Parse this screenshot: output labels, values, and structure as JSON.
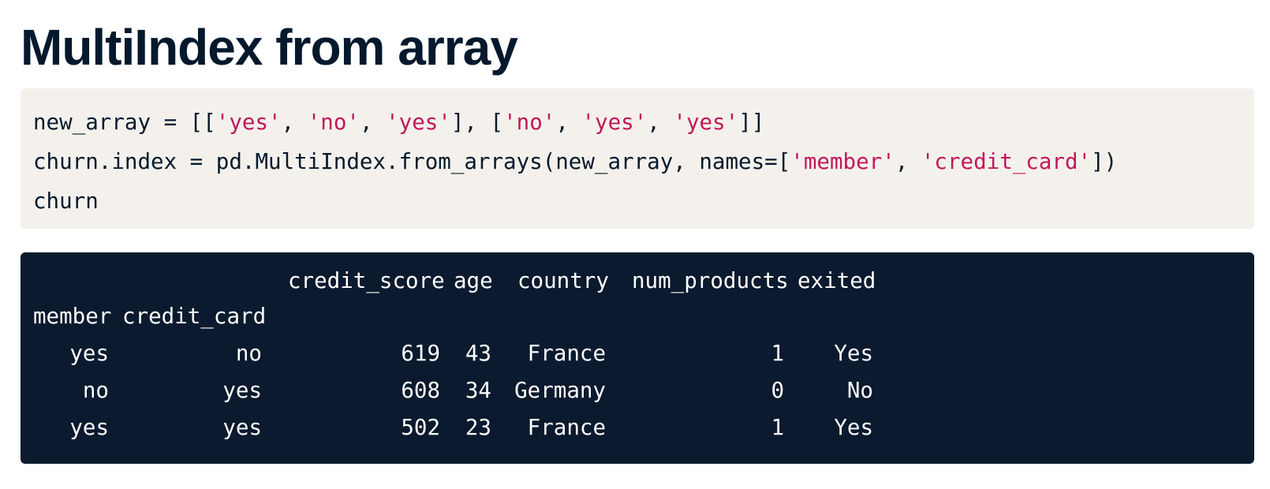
{
  "page": {
    "title": "MultiIndex from array"
  },
  "code_input": {
    "line1": [
      {
        "t": "new_array = [[",
        "s": false
      },
      {
        "t": "'yes'",
        "s": true
      },
      {
        "t": ", ",
        "s": false
      },
      {
        "t": "'no'",
        "s": true
      },
      {
        "t": ", ",
        "s": false
      },
      {
        "t": "'yes'",
        "s": true
      },
      {
        "t": "], [",
        "s": false
      },
      {
        "t": "'no'",
        "s": true
      },
      {
        "t": ", ",
        "s": false
      },
      {
        "t": "'yes'",
        "s": true
      },
      {
        "t": ", ",
        "s": false
      },
      {
        "t": "'yes'",
        "s": true
      },
      {
        "t": "]]",
        "s": false
      }
    ],
    "line2": [
      {
        "t": "churn.index = pd.MultiIndex.from_arrays(new_array, names=[",
        "s": false
      },
      {
        "t": "'member'",
        "s": true
      },
      {
        "t": ", ",
        "s": false
      },
      {
        "t": "'credit_card'",
        "s": true
      },
      {
        "t": "])",
        "s": false
      }
    ],
    "line3": [
      {
        "t": "churn",
        "s": false
      }
    ]
  },
  "code_output": {
    "header_columns": [
      "credit_score",
      "age",
      "country",
      "num_products",
      "exited"
    ],
    "index_names": [
      "member",
      "credit_card"
    ],
    "rows": [
      {
        "member": "yes",
        "credit_card": "no",
        "credit_score": "619",
        "age": "43",
        "country": "France",
        "num_products": "1",
        "exited": "Yes"
      },
      {
        "member": "no",
        "credit_card": "yes",
        "credit_score": "608",
        "age": "34",
        "country": "Germany",
        "num_products": "0",
        "exited": "No"
      },
      {
        "member": "yes",
        "credit_card": "yes",
        "credit_score": "502",
        "age": "23",
        "country": "France",
        "num_products": "1",
        "exited": "Yes"
      }
    ]
  },
  "colors": {
    "title": "#05192d",
    "code_input_bg": "#f4f1ec",
    "string": "#c2185b",
    "code_output_bg": "#0b1a2e",
    "code_output_text": "#ffffff"
  }
}
